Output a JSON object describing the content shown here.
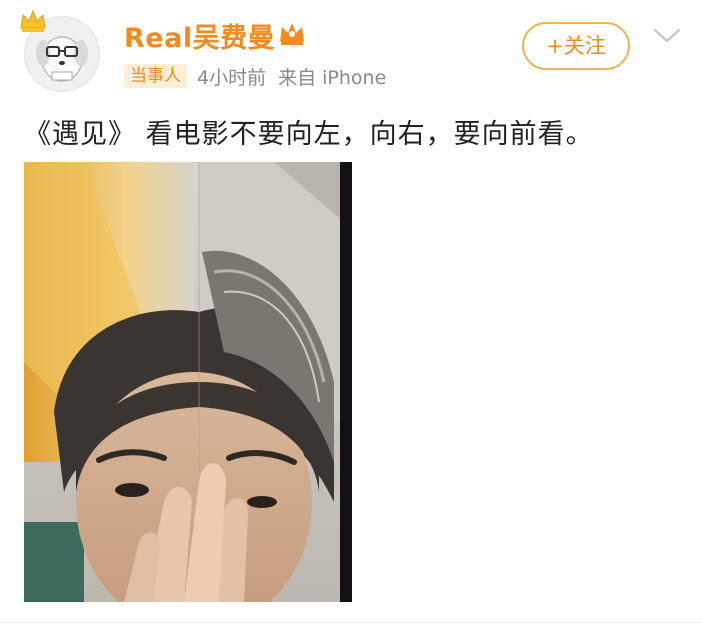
{
  "post": {
    "username": "Real吴费曼",
    "role_tag": "当事人",
    "time": "4小时前",
    "source": "来自 iPhone",
    "follow_label": "+关注",
    "text": "《遇见》 看电影不要向左，向右，要向前看。"
  },
  "icons": {
    "crown": "crown-icon",
    "verify": "vip-crown-badge-icon",
    "menu": "chevron-down-icon"
  },
  "colors": {
    "accent": "#f28a1d",
    "tag_bg": "#fdeed8",
    "meta": "#8a8a8a",
    "text": "#222222"
  }
}
